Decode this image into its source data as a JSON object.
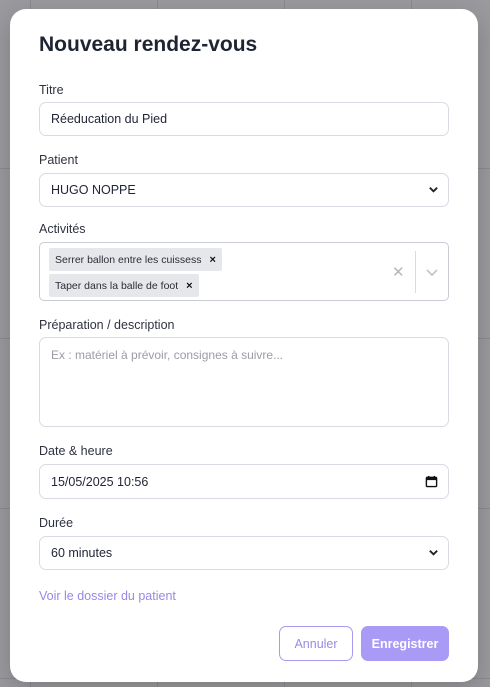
{
  "modal": {
    "title": "Nouveau rendez-vous"
  },
  "form": {
    "title_label": "Titre",
    "title_value": "Réeducation du Pied",
    "patient_label": "Patient",
    "patient_value": "HUGO NOPPE",
    "activities_label": "Activités",
    "activities": [
      "Serrer ballon entre les cuissess",
      "Taper dans la balle de foot"
    ],
    "description_label": "Préparation / description",
    "description_placeholder": "Ex : matériel à prévoir, consignes à suivre...",
    "datetime_label": "Date & heure",
    "datetime_value": "15/05/2025 10:56",
    "duration_label": "Durée",
    "duration_value": "60 minutes"
  },
  "links": {
    "patient_file": "Voir le dossier du patient"
  },
  "buttons": {
    "cancel": "Annuler",
    "save": "Enregistrer"
  },
  "colors": {
    "accent": "#a99af5",
    "link": "#9b86e6"
  }
}
